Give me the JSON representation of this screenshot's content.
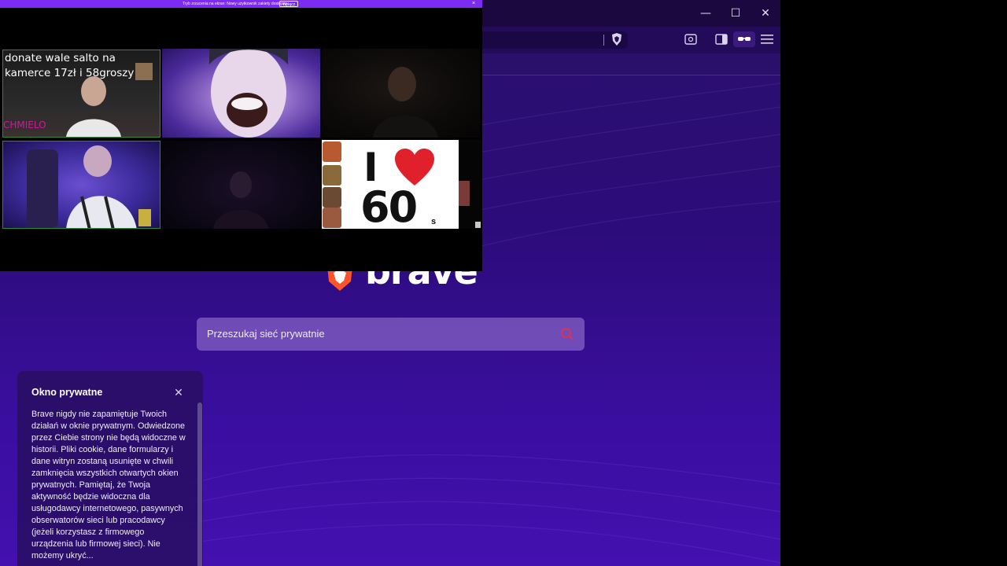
{
  "video_overlay": {
    "banner_text": "Tryb zrzucenia na ekran: Nowy użytkownik zakiety dostępny",
    "banner_button": "Wyłącz",
    "banner_close": "×",
    "donate_text": "donate wale salto na kamerce 17zł i 58groszy",
    "tile1_name": "CHMIELO",
    "sticker": {
      "i": "I",
      "sixty": "60",
      "s": "s"
    }
  },
  "browser": {
    "window_controls": {
      "minimize": "—",
      "maximize": "☐",
      "close": "✕"
    },
    "logo_wordmark": "brave",
    "search": {
      "placeholder": "Przeszukaj sieć prywatnie"
    }
  },
  "private_card": {
    "title": "Okno prywatne",
    "body": "Brave nigdy nie zapamiętuje Twoich działań w oknie prywatnym. Odwiedzone przez Ciebie strony nie będą widoczne w historii. Pliki cookie, dane formularzy i dane witryn zostaną usunięte w chwili zamknięcia wszystkich otwartych okien prywatnych. Pamiętaj, że Twoja aktywność będzie widoczna dla usługodawcy internetowego, pasywnych obserwatorów sieci lub pracodawcy (jeżeli korzystasz z firmowego urządzenia lub firmowej sieci). Nie możemy ukryć..."
  },
  "colors": {
    "brave_accent": "#fb542b",
    "page_bg": "#2c0c7a",
    "banner": "#7b2cf0",
    "heart": "#e0202a"
  }
}
